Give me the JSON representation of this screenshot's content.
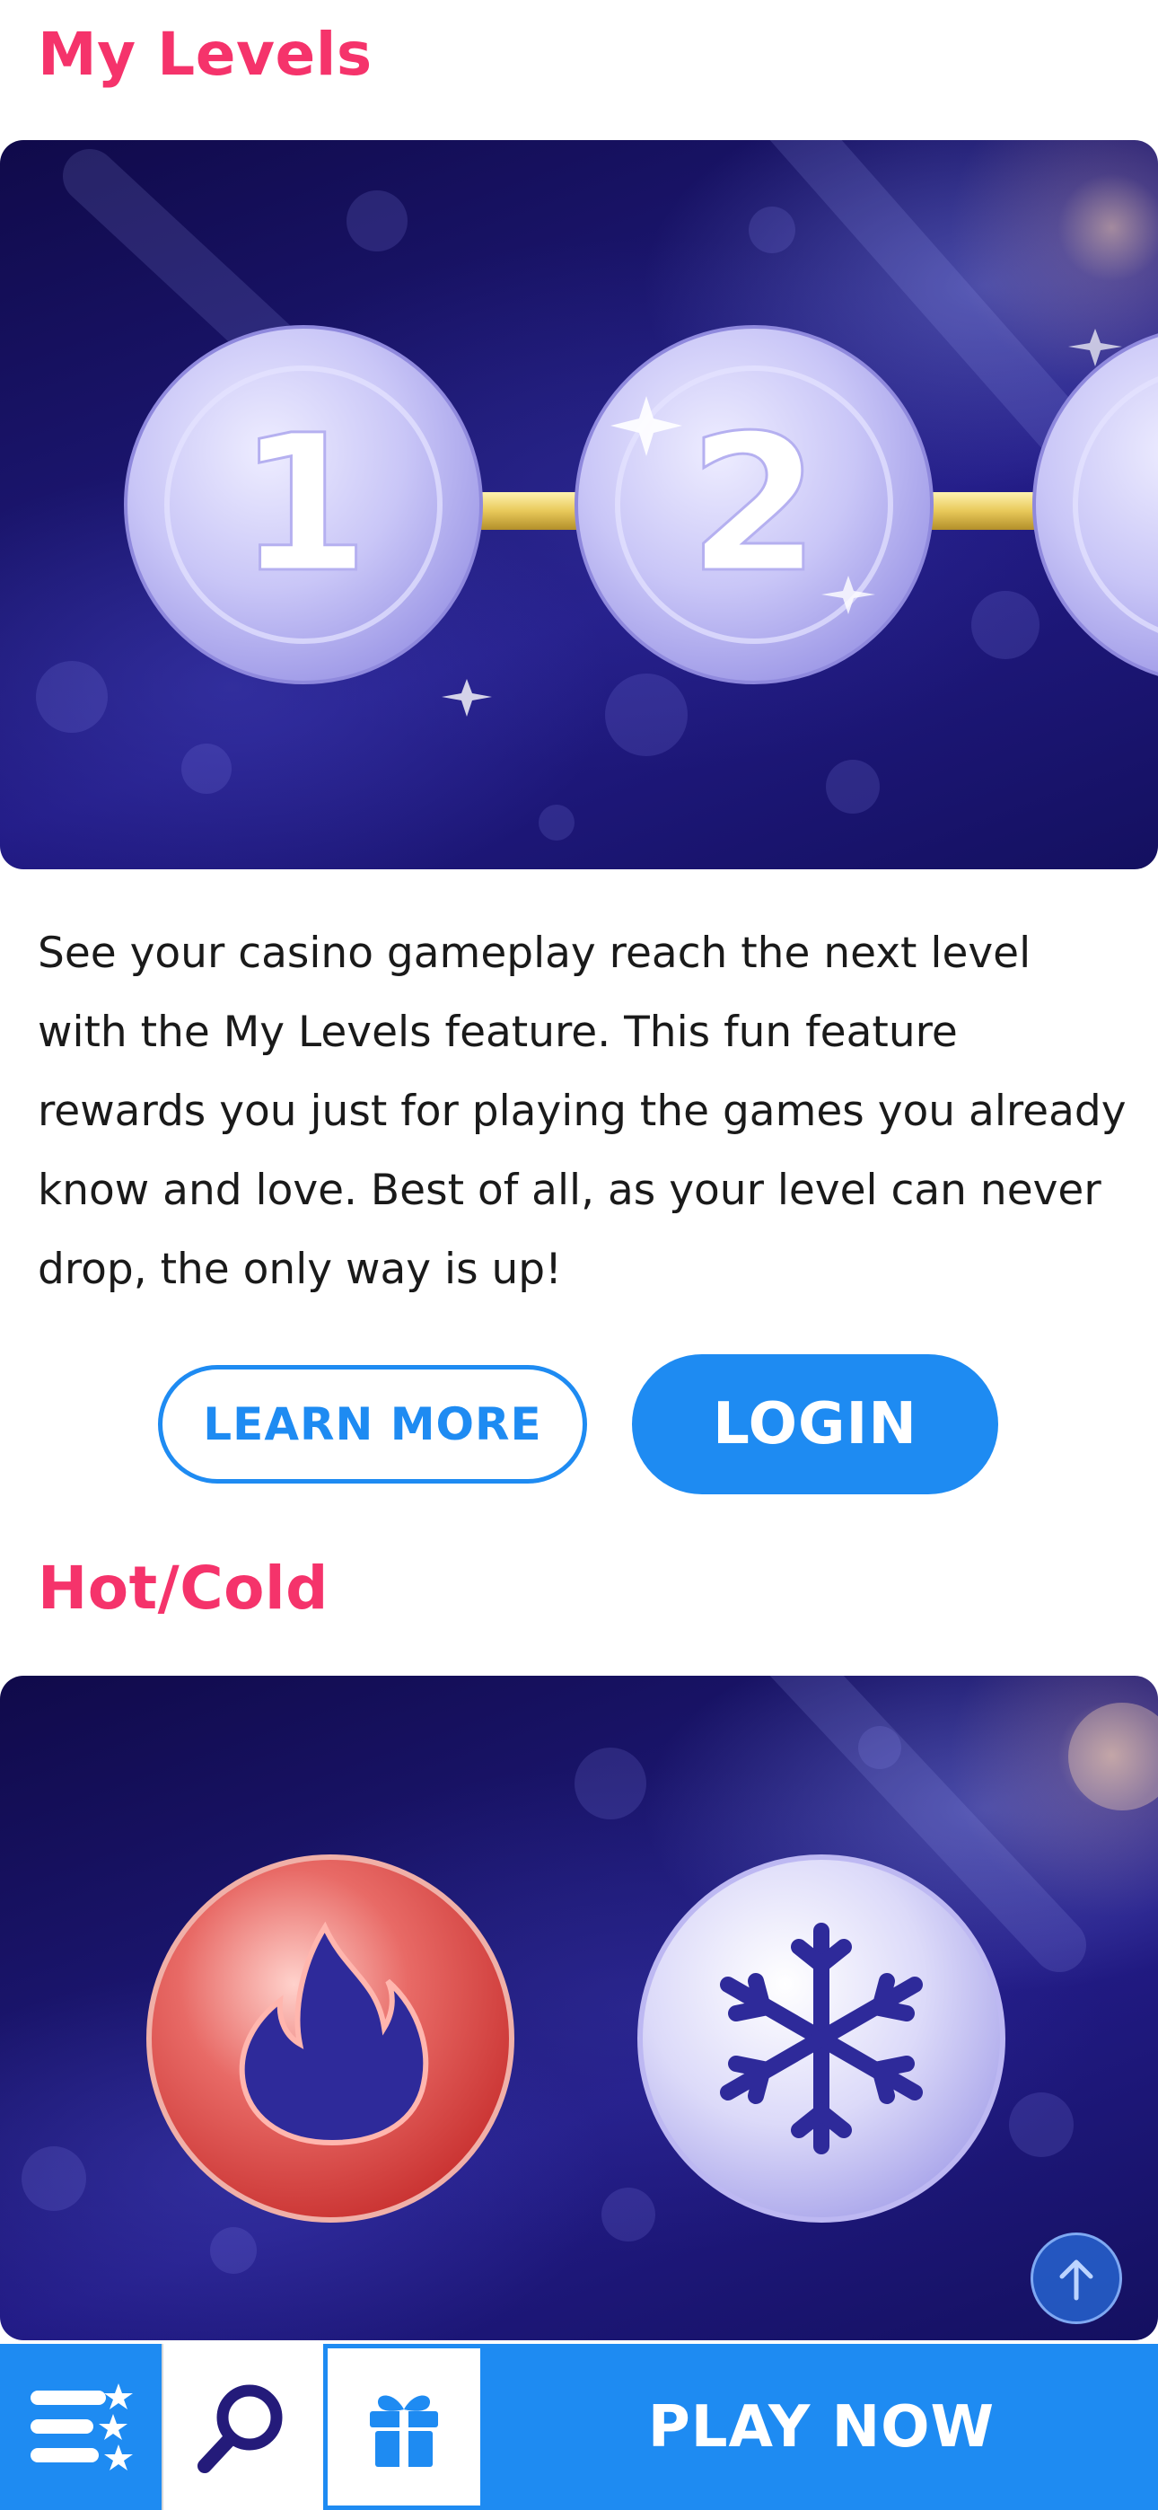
{
  "sections": {
    "levels": {
      "title": "My Levels",
      "level_numbers": [
        "1",
        "2"
      ],
      "description": "See your casino gameplay reach the next level with the My Levels feature. This fun feature rewards you just for playing the games you already know and love. Best of all, as your level can never drop, the only way is up!",
      "learn_more_label": "LEARN MORE",
      "login_label": "LOGIN"
    },
    "hotcold": {
      "title": "Hot/Cold",
      "icons": [
        "flame-icon",
        "snowflake-icon"
      ]
    }
  },
  "bottom_bar": {
    "play_now_label": "PLAY NOW",
    "icons": [
      "menu-stars-icon",
      "search-icon",
      "gift-icon"
    ]
  },
  "colors": {
    "accent_pink": "#f5336b",
    "primary_blue": "#1e8bf2",
    "banner_navy": "#1c1773",
    "chip_lavender": "#c9c6f7",
    "hot_red": "#e0484a"
  }
}
